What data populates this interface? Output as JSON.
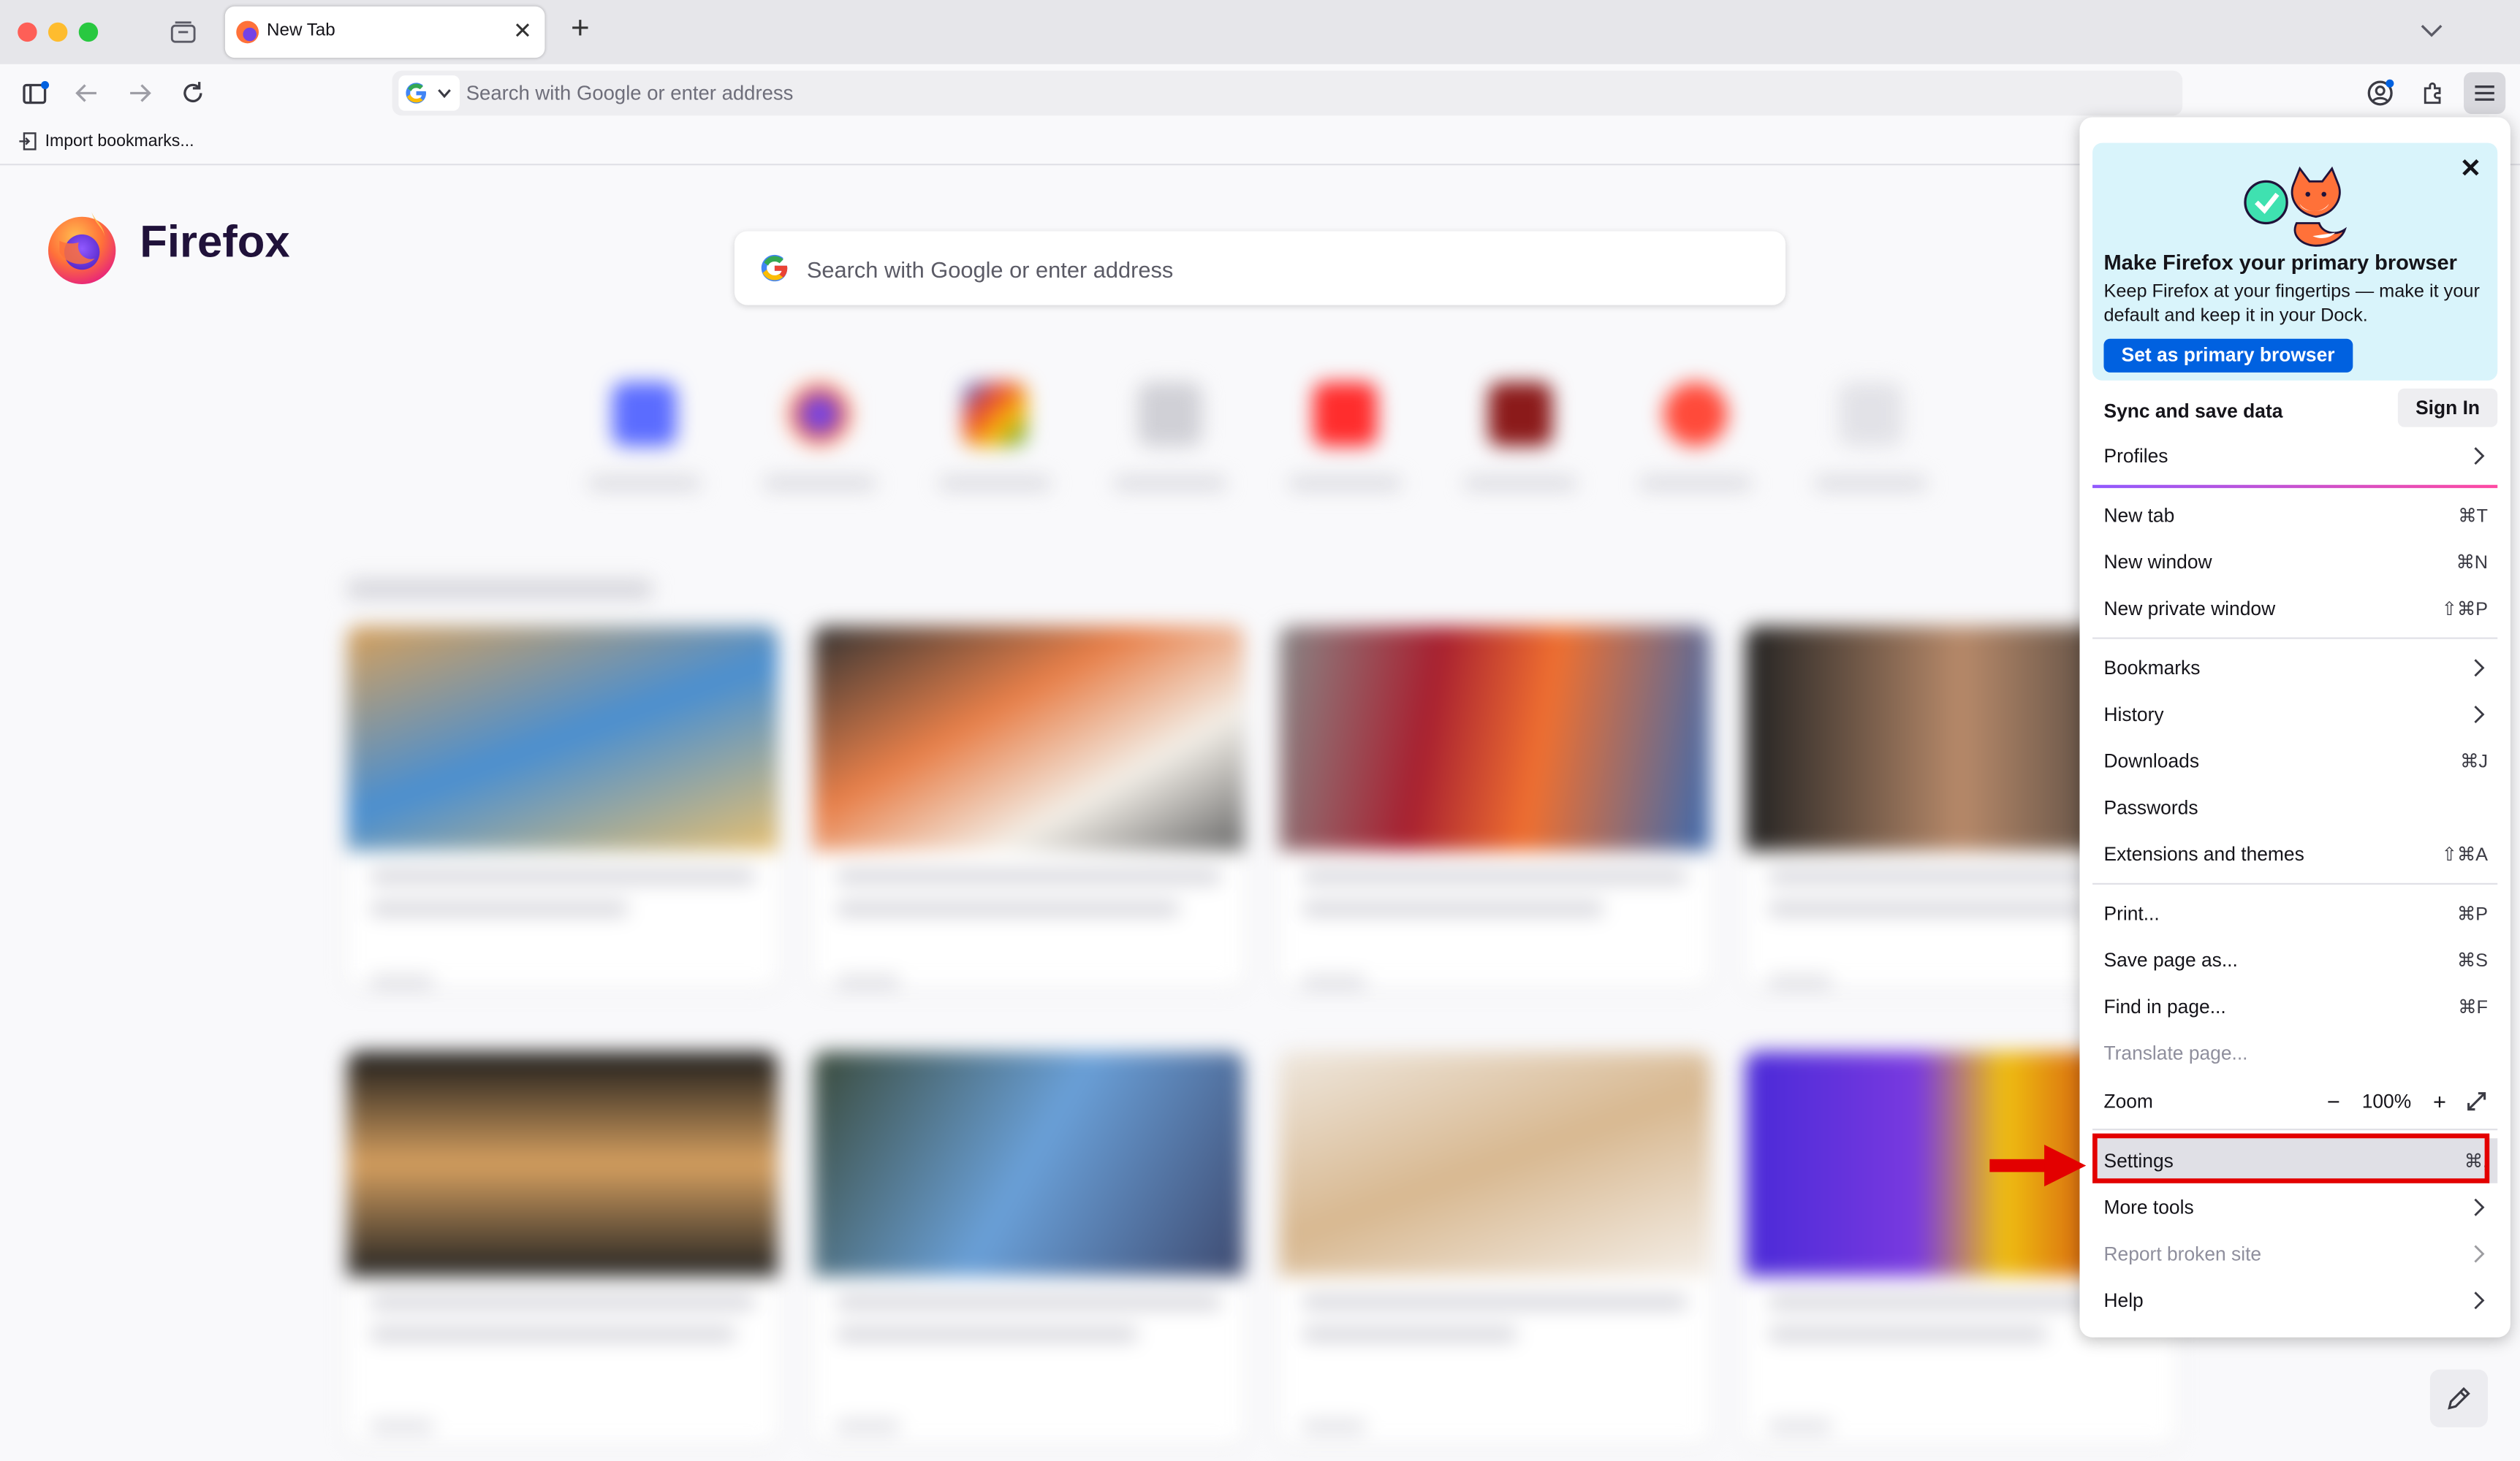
{
  "tab": {
    "title": "New Tab"
  },
  "urlbar": {
    "placeholder": "Search with Google or enter address"
  },
  "bookmarks": {
    "import_label": "Import bookmarks..."
  },
  "newtab": {
    "brand": "Firefox",
    "search_placeholder": "Search with Google or enter address"
  },
  "menu": {
    "promo": {
      "heading": "Make Firefox your primary browser",
      "body": "Keep Firefox at your fingertips — make it your default and keep it in your Dock.",
      "button": "Set as primary browser"
    },
    "sync_label": "Sync and save data",
    "sign_in": "Sign In",
    "profiles": "Profiles",
    "new_tab": {
      "label": "New tab",
      "shortcut": "⌘T"
    },
    "new_window": {
      "label": "New window",
      "shortcut": "⌘N"
    },
    "new_private_window": {
      "label": "New private window",
      "shortcut": "⇧⌘P"
    },
    "bookmarks": "Bookmarks",
    "history": "History",
    "downloads": {
      "label": "Downloads",
      "shortcut": "⌘J"
    },
    "passwords": "Passwords",
    "extensions": {
      "label": "Extensions and themes",
      "shortcut": "⇧⌘A"
    },
    "print": {
      "label": "Print...",
      "shortcut": "⌘P"
    },
    "save_page": {
      "label": "Save page as...",
      "shortcut": "⌘S"
    },
    "find": {
      "label": "Find in page...",
      "shortcut": "⌘F"
    },
    "translate": "Translate page...",
    "zoom": {
      "label": "Zoom",
      "minus": "−",
      "value": "100%",
      "plus": "+"
    },
    "settings": {
      "label": "Settings",
      "shortcut": "⌘,"
    },
    "more_tools": "More tools",
    "report_broken": "Report broken site",
    "help": "Help"
  },
  "colors": {
    "accent": "#0061e0",
    "annotation": "#e30000",
    "promo_bg": "#d9f4fb"
  },
  "icons": [
    "tab-list-icon",
    "close-icon",
    "plus-icon",
    "chevron-down-icon",
    "sidebar-icon",
    "back-arrow-icon",
    "forward-arrow-icon",
    "reload-icon",
    "google-icon",
    "account-icon",
    "extensions-icon",
    "hamburger-menu-icon",
    "import-icon",
    "firefox-logo-icon",
    "chevron-right-icon",
    "fullscreen-icon",
    "pencil-icon"
  ]
}
